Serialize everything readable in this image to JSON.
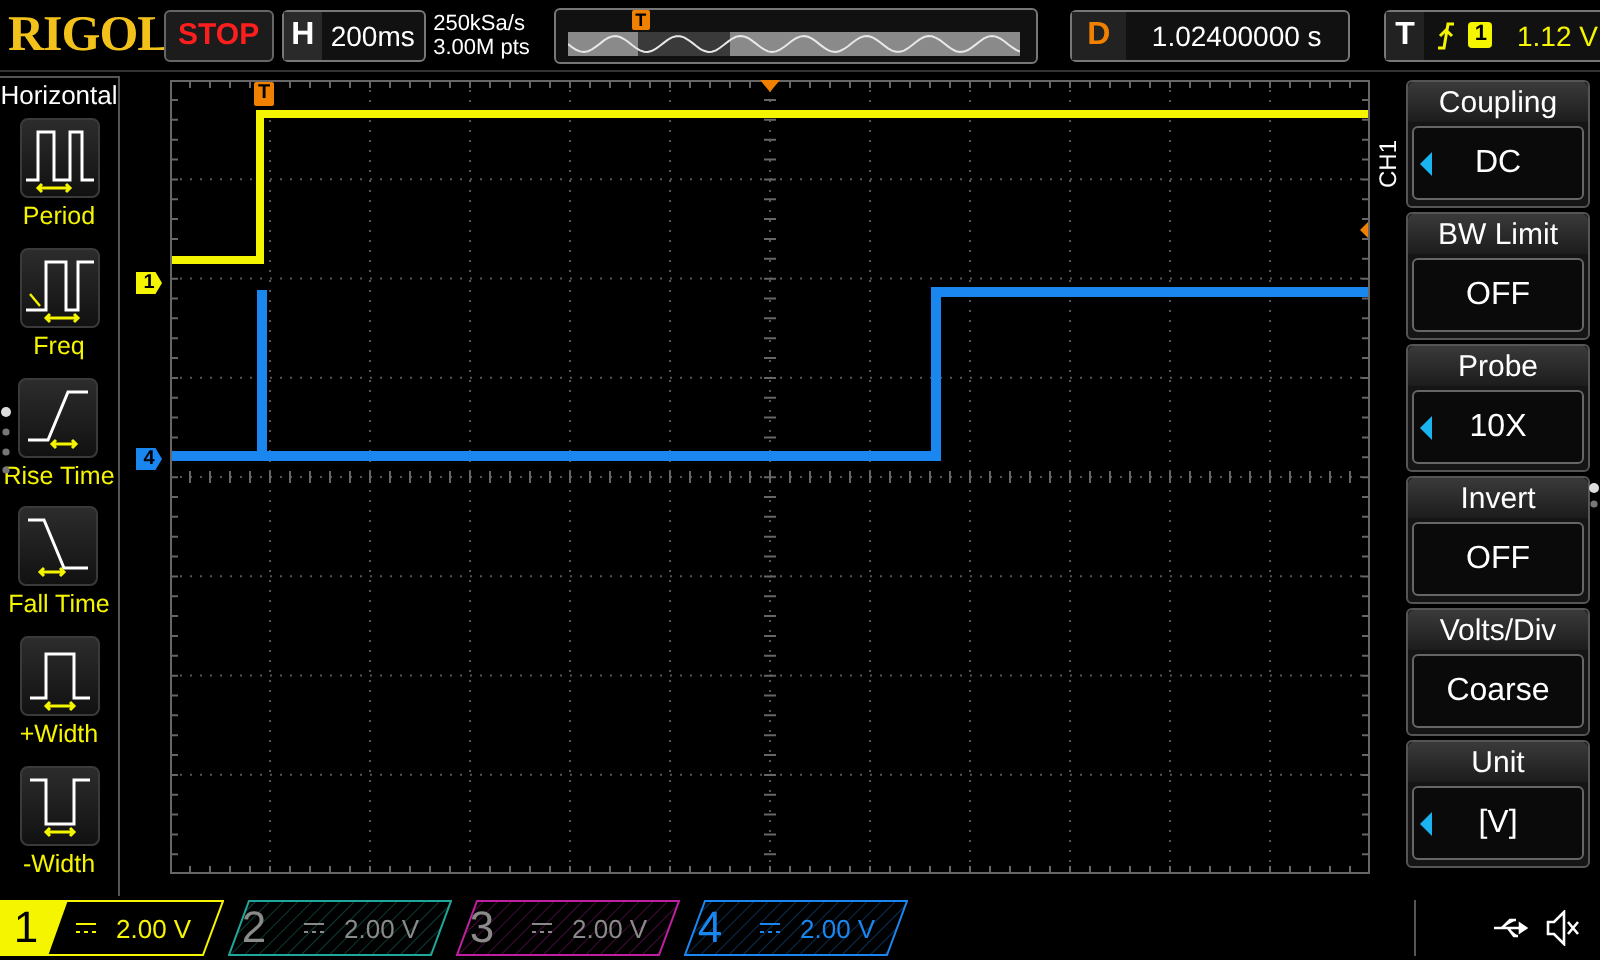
{
  "header": {
    "logo": "RIGOL",
    "run_state": "STOP",
    "horizontal": {
      "label": "H",
      "timebase": "200ms"
    },
    "sample_rate": "250kSa/s",
    "memory_depth": "3.00M pts",
    "overview": {
      "trigger_marker": "T"
    },
    "delay": {
      "label": "D",
      "value": "1.02400000 s"
    },
    "trigger": {
      "label": "T",
      "source": "1",
      "level": "1.12 V"
    }
  },
  "sidebar": {
    "title": "Horizontal",
    "items": [
      {
        "label": "Period",
        "kind": "period"
      },
      {
        "label": "Freq",
        "kind": "freq"
      },
      {
        "label": "Rise Time",
        "kind": "rise"
      },
      {
        "label": "Fall Time",
        "kind": "fall"
      },
      {
        "label": "+Width",
        "kind": "pwidth"
      },
      {
        "label": "-Width",
        "kind": "nwidth"
      }
    ]
  },
  "plot": {
    "trigger_marker": "T",
    "channel_markers": [
      {
        "label": "1",
        "color": "#f5f500"
      },
      {
        "label": "4",
        "color": "#1a86f0"
      }
    ]
  },
  "menu": {
    "channel": "CH1",
    "items": [
      {
        "title": "Coupling",
        "value": "DC",
        "adjustable": true
      },
      {
        "title": "BW Limit",
        "value": "OFF",
        "adjustable": false
      },
      {
        "title": "Probe",
        "value": "10X",
        "adjustable": true
      },
      {
        "title": "Invert",
        "value": "OFF",
        "adjustable": false
      },
      {
        "title": "Volts/Div",
        "value": "Coarse",
        "adjustable": false
      },
      {
        "title": "Unit",
        "value": "[V]",
        "adjustable": true
      }
    ]
  },
  "channels": [
    {
      "number": "1",
      "scale": "2.00 V",
      "on": true,
      "selected": true,
      "color": "#f5f500"
    },
    {
      "number": "2",
      "scale": "2.00 V",
      "on": false,
      "selected": false,
      "color": "#1fa89a"
    },
    {
      "number": "3",
      "scale": "2.00 V",
      "on": false,
      "selected": false,
      "color": "#c020a0"
    },
    {
      "number": "4",
      "scale": "2.00 V",
      "on": true,
      "selected": false,
      "color": "#1a86f0"
    }
  ]
}
